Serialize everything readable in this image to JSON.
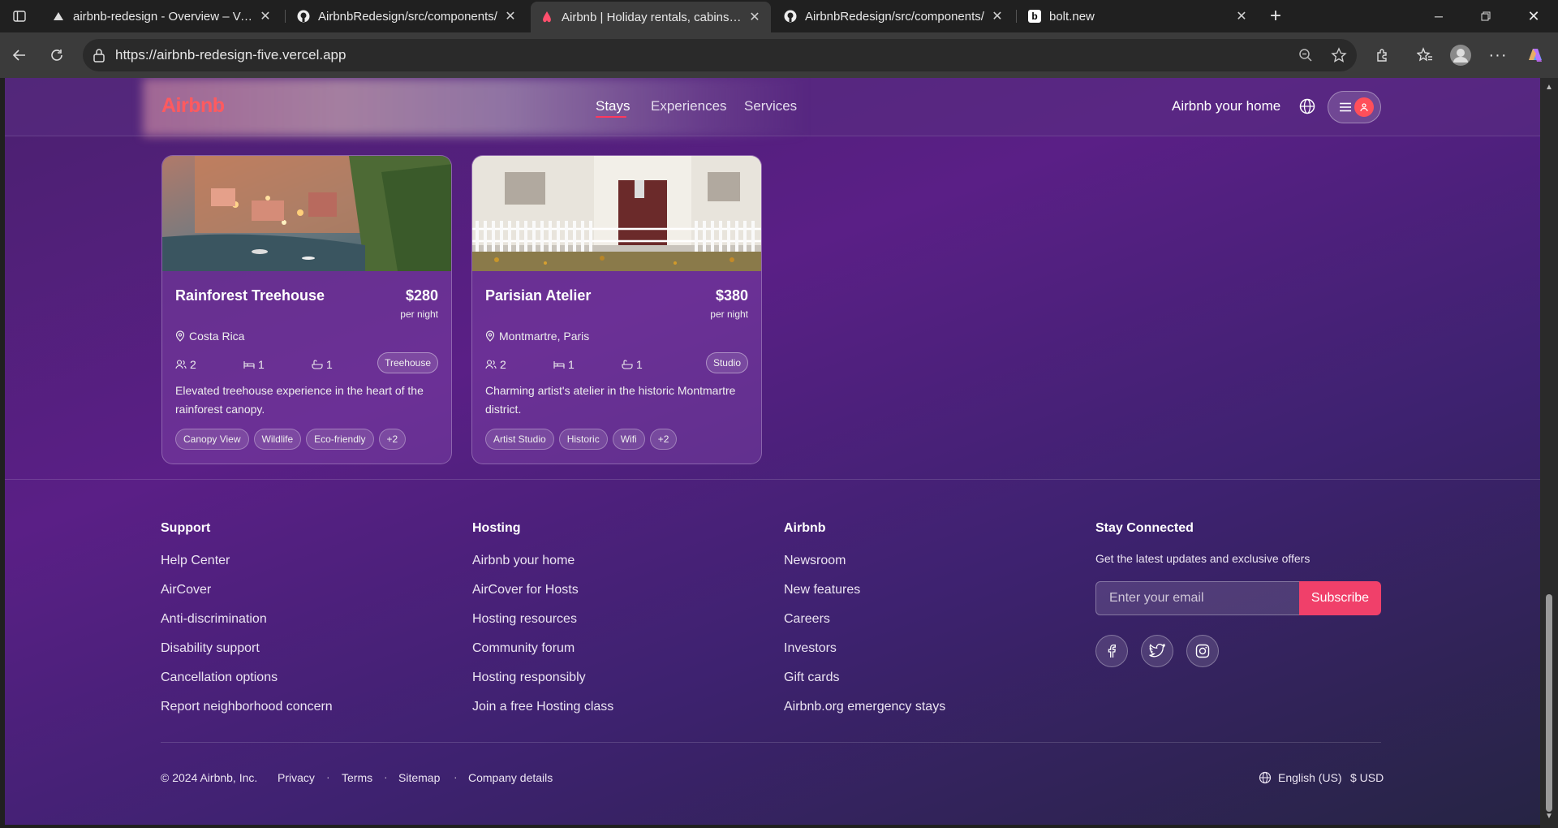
{
  "browser": {
    "tabs": [
      {
        "title": "airbnb-redesign - Overview – Vercel",
        "icon": "vercel-icon"
      },
      {
        "title": "AirbnbRedesign/src/components/",
        "icon": "github-icon"
      },
      {
        "title": "Airbnb | Holiday rentals, cabins, beach houses",
        "icon": "airbnb-icon"
      },
      {
        "title": "AirbnbRedesign/src/components/",
        "icon": "github-icon"
      },
      {
        "title": "bolt.new",
        "icon": "bolt-icon"
      }
    ],
    "url": "https://airbnb-redesign-five.vercel.app"
  },
  "header": {
    "logo": "Airbnb",
    "nav": [
      "Stays",
      "Experiences",
      "Services"
    ],
    "active_nav": "Stays",
    "host_link": "Airbnb your home"
  },
  "listings": [
    {
      "title": "Rainforest Treehouse",
      "price": "$280",
      "per": "per night",
      "location": "Costa Rica",
      "guests": "2",
      "beds": "1",
      "baths": "1",
      "type": "Treehouse",
      "description": "Elevated treehouse experience in the heart of the rainforest canopy.",
      "tags": [
        "Canopy View",
        "Wildlife",
        "Eco-friendly",
        "+2"
      ]
    },
    {
      "title": "Parisian Atelier",
      "price": "$380",
      "per": "per night",
      "location": "Montmartre, Paris",
      "guests": "2",
      "beds": "1",
      "baths": "1",
      "type": "Studio",
      "description": "Charming artist's atelier in the historic Montmartre district.",
      "tags": [
        "Artist Studio",
        "Historic",
        "Wifi",
        "+2"
      ]
    }
  ],
  "footer": {
    "columns": [
      {
        "heading": "Support",
        "links": [
          "Help Center",
          "AirCover",
          "Anti-discrimination",
          "Disability support",
          "Cancellation options",
          "Report neighborhood concern"
        ]
      },
      {
        "heading": "Hosting",
        "links": [
          "Airbnb your home",
          "AirCover for Hosts",
          "Hosting resources",
          "Community forum",
          "Hosting responsibly",
          "Join a free Hosting class"
        ]
      },
      {
        "heading": "Airbnb",
        "links": [
          "Newsroom",
          "New features",
          "Careers",
          "Investors",
          "Gift cards",
          "Airbnb.org emergency stays"
        ]
      }
    ],
    "connect": {
      "heading": "Stay Connected",
      "subtitle": "Get the latest updates and exclusive offers",
      "email_placeholder": "Enter your email",
      "subscribe": "Subscribe",
      "socials": [
        "facebook-icon",
        "twitter-icon",
        "instagram-icon"
      ]
    },
    "bottom": {
      "copyright": "© 2024 Airbnb, Inc.",
      "links": [
        "Privacy",
        "Terms",
        "Sitemap",
        "Company details"
      ],
      "language": "English (US)",
      "currency": "$ USD"
    }
  },
  "colors": {
    "brand": "#ff5a5f",
    "subscribe": "#f0406a",
    "nav_underline": "#ff385c"
  }
}
